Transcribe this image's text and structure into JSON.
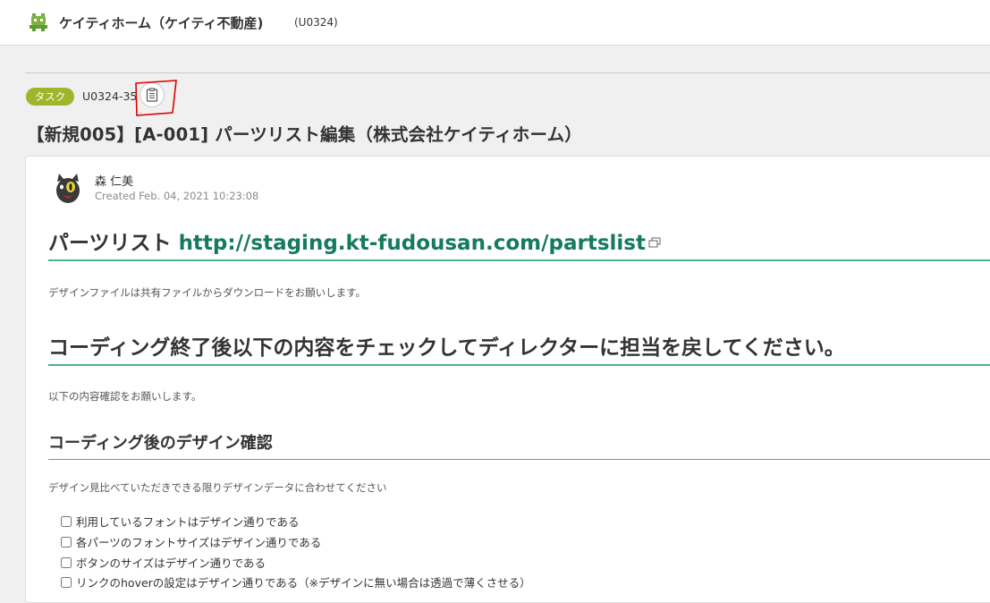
{
  "header": {
    "project_name": "ケイティホーム（ケイティ不動産)",
    "project_key": "(U0324)"
  },
  "issue": {
    "type_badge": "タスク",
    "key": "U0324-35",
    "title": "【新規005】[A-001] パーツリスト編集（株式会社ケイティホーム）"
  },
  "post": {
    "author": "森 仁美",
    "created": "Created Feb. 04, 2021 10:23:08"
  },
  "content": {
    "heading1_text": "パーツリスト ",
    "heading1_link": "http://staging.kt-fudousan.com/partslist",
    "para1": "デザインファイルは共有ファイルからダウンロードをお願いします。",
    "heading2": "コーディング終了後以下の内容をチェックしてディレクターに担当を戻してください。",
    "para2": "以下の内容確認をお願いします。",
    "heading3": "コーディング後のデザイン確認",
    "para3": "デザイン見比べていただきできる限りデザインデータに合わせてください",
    "checklist": [
      {
        "label": "利用しているフォントはデザイン通りである",
        "checked": false
      },
      {
        "label": "各パーツのフォントサイズはデザイン通りである",
        "checked": false
      },
      {
        "label": "ボタンのサイズはデザイン通りである",
        "checked": false
      },
      {
        "label": "リンクのhoverの設定はデザイン通りである（※デザインに無い場合は透過で薄くさせる）",
        "checked": false
      }
    ]
  },
  "colors": {
    "badge": "#a0b52c",
    "link": "#157a5e",
    "heading_rule": "#4caf8e",
    "highlight": "#e00000"
  },
  "icons": [
    "project-logo-icon",
    "clipboard-icon",
    "external-link-icon",
    "avatar-cat-icon"
  ]
}
